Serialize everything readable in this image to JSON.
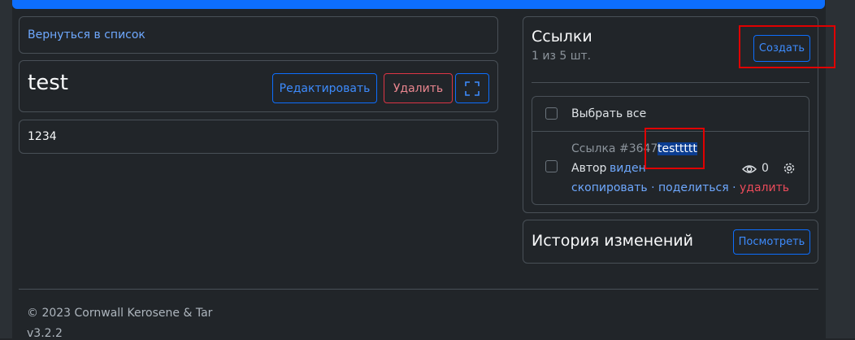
{
  "nav": {
    "back_link": "Вернуться в список"
  },
  "doc": {
    "title": "test",
    "edit_label": "Редактировать",
    "delete_label": "Удалить",
    "content": "1234"
  },
  "links_panel": {
    "title": "Ссылки",
    "count": "1 из 5 шт.",
    "create_label": "Создать",
    "select_all": "Выбрать все",
    "item": {
      "prefix": "Ссылка #3647",
      "name": "testtttt",
      "author_label": "Автор",
      "author_value": "виден",
      "views": "0",
      "copy": "скопировать",
      "sep1": "·",
      "share": "поделиться",
      "sep2": "·",
      "remove": "удалить"
    }
  },
  "history": {
    "title": "История изменений",
    "view_label": "Посмотреть"
  },
  "footer": {
    "copyright": "© 2023 Cornwall Kerosene & Tar",
    "version": "v3.2.2"
  },
  "colors": {
    "accent": "#0d6efd",
    "danger": "#dc3545",
    "highlight": "#0b3d91",
    "annotation": "#e00000"
  }
}
